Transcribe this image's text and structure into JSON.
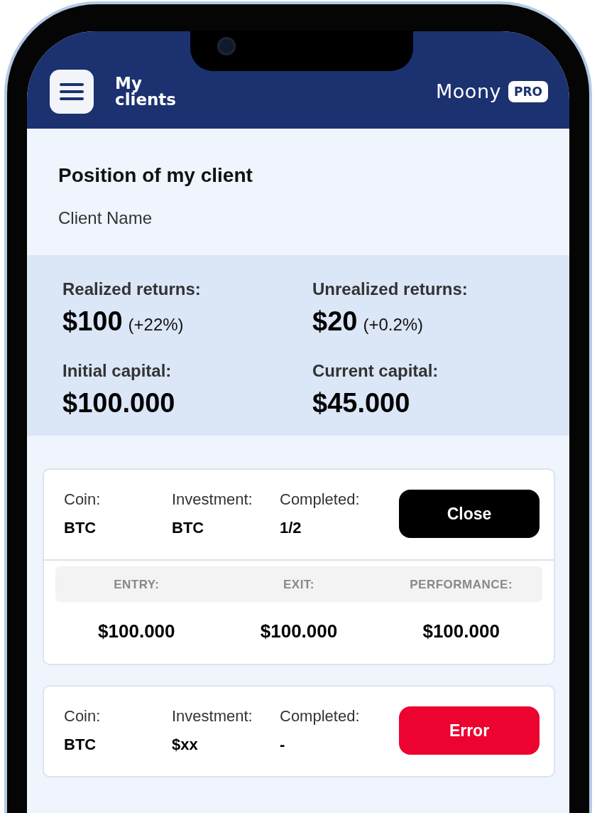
{
  "header": {
    "title": "My clients",
    "brand": "Moony",
    "badge": "PRO"
  },
  "position": {
    "title": "Position of my client",
    "client": "Client Name"
  },
  "stats": [
    {
      "label": "Realized returns:",
      "value": "$100",
      "change": "(+22%)"
    },
    {
      "label": "Unrealized returns:",
      "value": "$20",
      "change": "(+0.2%)"
    },
    {
      "label": "Initial capital:",
      "value": "$100.000"
    },
    {
      "label": "Current capital:",
      "value": "$45.000"
    }
  ],
  "positions": [
    {
      "fields": [
        {
          "label": "Coin:",
          "value": "BTC"
        },
        {
          "label": "Investment:",
          "value": "BTC"
        },
        {
          "label": "Completed:",
          "value": "1/2"
        }
      ],
      "action": {
        "label": "Close",
        "kind": "close"
      },
      "breakdown": {
        "columns": [
          "ENTRY:",
          "EXIT:",
          "PERFORMANCE:"
        ],
        "values": [
          "$100.000",
          "$100.000",
          "$100.000"
        ]
      }
    },
    {
      "fields": [
        {
          "label": "Coin:",
          "value": "BTC"
        },
        {
          "label": "Investment:",
          "value": "$xx"
        },
        {
          "label": "Completed:",
          "value": "-"
        }
      ],
      "action": {
        "label": "Error",
        "kind": "error"
      }
    }
  ]
}
